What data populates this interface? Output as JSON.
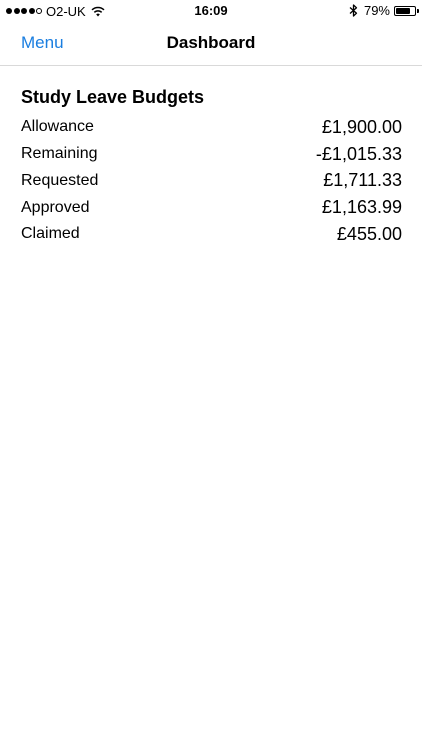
{
  "status_bar": {
    "carrier": "O2-UK",
    "time": "16:09",
    "battery_percent": "79%",
    "battery_level": 0.79,
    "signal_bars": 4,
    "signal_max": 5
  },
  "nav": {
    "back_label": "Menu",
    "title": "Dashboard",
    "accent_color": "#1a7ee0"
  },
  "budgets": {
    "title": "Study Leave Budgets",
    "rows": [
      {
        "label": "Allowance",
        "value": "£1,900.00"
      },
      {
        "label": "Remaining",
        "value": "-£1,015.33"
      },
      {
        "label": "Requested",
        "value": "£1,711.33"
      },
      {
        "label": "Approved",
        "value": "£1,163.99"
      },
      {
        "label": "Claimed",
        "value": "£455.00"
      }
    ]
  }
}
